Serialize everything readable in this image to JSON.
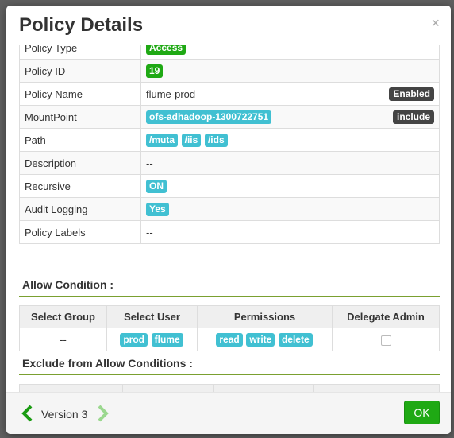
{
  "modal": {
    "title": "Policy Details",
    "close_glyph": "×"
  },
  "details": {
    "policy_type_label": "Policy Type",
    "policy_type_value": "Access",
    "policy_id_label": "Policy ID",
    "policy_id_value": "19",
    "policy_name_label": "Policy Name",
    "policy_name_value": "flume-prod",
    "policy_name_status": "Enabled",
    "mountpoint_label": "MountPoint",
    "mountpoint_value": "ofs-adhadoop-1300722751",
    "mountpoint_mode": "include",
    "path_label": "Path",
    "paths": [
      "/muta",
      "/iis",
      "/ids"
    ],
    "description_label": "Description",
    "description_value": "--",
    "recursive_label": "Recursive",
    "recursive_value": "ON",
    "audit_label": "Audit Logging",
    "audit_value": "Yes",
    "labels_label": "Policy Labels",
    "labels_value": "--"
  },
  "allow": {
    "title": "Allow Condition :",
    "headers": [
      "Select Group",
      "Select User",
      "Permissions",
      "Delegate Admin"
    ],
    "row": {
      "group": "--",
      "users": [
        "prod",
        "flume"
      ],
      "permissions": [
        "read",
        "write",
        "delete"
      ],
      "delegate_admin": false
    }
  },
  "exclude": {
    "title": "Exclude from Allow Conditions :"
  },
  "footer": {
    "version": "Version 3",
    "ok_label": "OK"
  },
  "colors": {
    "tag_cyan": "#41c0d2",
    "tag_green": "#1fa914",
    "badge_dark": "#444444",
    "nav_prev": "#1b9c13",
    "nav_next": "#9bd88f",
    "section_line": "#7aa030"
  }
}
